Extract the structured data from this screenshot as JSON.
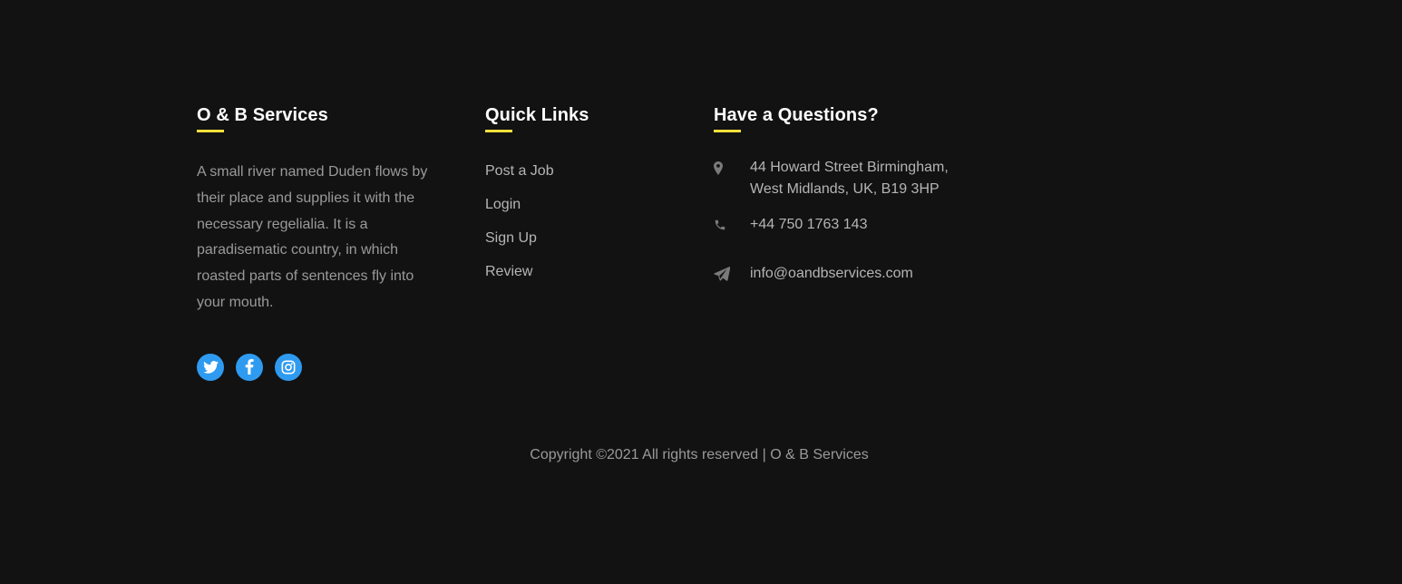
{
  "colors": {
    "background": "#121212",
    "heading": "#ffffff",
    "accent_bar": "#f7e03c",
    "body_text": "#9a9a9a",
    "link_text": "#b5b5b5",
    "social_bg": "#2f9bf0"
  },
  "about": {
    "title": "O & B Services",
    "text": "A small river named Duden flows by their place and supplies it with the necessary regelialia. It is a paradisematic country, in which roasted parts of sentences fly into your mouth.",
    "social": [
      {
        "name": "Twitter",
        "icon": "twitter-icon"
      },
      {
        "name": "Facebook",
        "icon": "facebook-icon"
      },
      {
        "name": "Instagram",
        "icon": "instagram-icon"
      }
    ]
  },
  "quick_links": {
    "title": "Quick Links",
    "items": [
      "Post a Job",
      "Login",
      "Sign Up",
      "Review"
    ]
  },
  "contact": {
    "title": "Have a Questions?",
    "address": "44 Howard Street Birmingham, West Midlands, UK, B19 3HP",
    "address_icon": "map-marker-icon",
    "phone": "+44 750 1763 143",
    "phone_icon": "phone-icon",
    "email": "info@oandbservices.com",
    "email_icon": "paper-plane-icon"
  },
  "copyright": "Copyright ©2021 All rights reserved | O & B Services"
}
